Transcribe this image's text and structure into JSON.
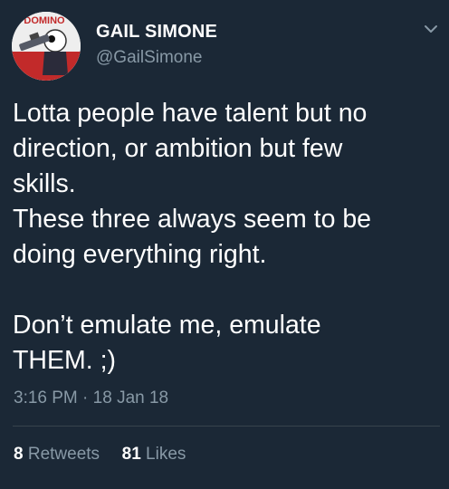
{
  "author": {
    "name": "GAIL SIMONE",
    "handle": "@GailSimone",
    "avatar_text": "DOMINO"
  },
  "tweet": {
    "lines": [
      "Lotta people have talent but no",
      "direction, or ambition but few",
      "skills.",
      "These three always seem to be",
      "doing everything right.",
      "",
      "Don’t emulate me, emulate",
      "THEM. ;)"
    ],
    "time": "3:16 PM",
    "separator": "·",
    "date": "18 Jan 18"
  },
  "stats": {
    "retweets_count": "8",
    "retweets_label": "Retweets",
    "likes_count": "81",
    "likes_label": "Likes"
  },
  "colors": {
    "background": "#1b2836",
    "secondary_text": "#8899a6",
    "divider": "#38444d"
  },
  "icons": {
    "menu": "chevron-down-icon"
  }
}
